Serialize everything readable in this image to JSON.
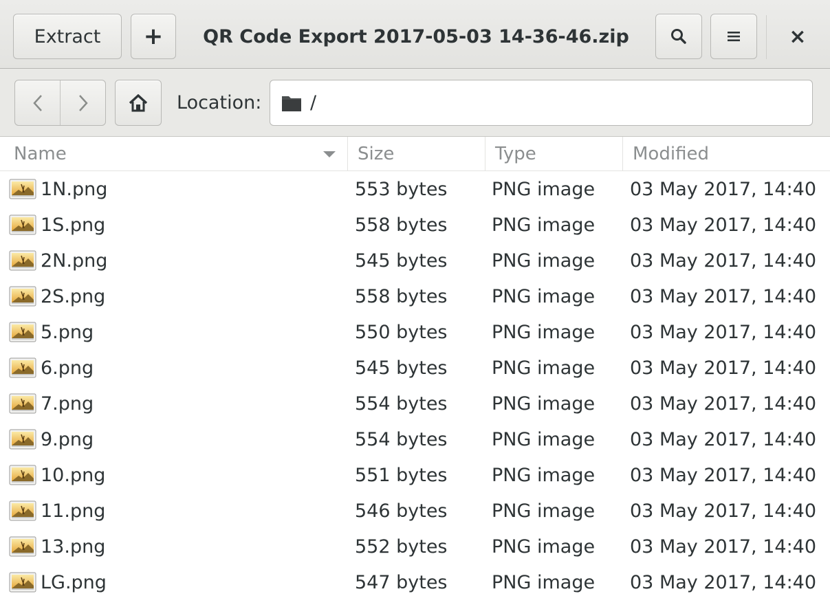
{
  "header": {
    "extract_label": "Extract",
    "add_label": "+",
    "title": "QR Code Export 2017-05-03 14-36-46.zip",
    "close_label": "×"
  },
  "locationbar": {
    "back_label": "<",
    "forward_label": ">",
    "location_label": "Location:",
    "path": "/"
  },
  "columns": {
    "name": "Name",
    "size": "Size",
    "type": "Type",
    "modified": "Modified"
  },
  "files": [
    {
      "name": "1N.png",
      "size": "553 bytes",
      "type": "PNG image",
      "modified": "03 May 2017, 14:40"
    },
    {
      "name": "1S.png",
      "size": "558 bytes",
      "type": "PNG image",
      "modified": "03 May 2017, 14:40"
    },
    {
      "name": "2N.png",
      "size": "545 bytes",
      "type": "PNG image",
      "modified": "03 May 2017, 14:40"
    },
    {
      "name": "2S.png",
      "size": "558 bytes",
      "type": "PNG image",
      "modified": "03 May 2017, 14:40"
    },
    {
      "name": "5.png",
      "size": "550 bytes",
      "type": "PNG image",
      "modified": "03 May 2017, 14:40"
    },
    {
      "name": "6.png",
      "size": "545 bytes",
      "type": "PNG image",
      "modified": "03 May 2017, 14:40"
    },
    {
      "name": "7.png",
      "size": "554 bytes",
      "type": "PNG image",
      "modified": "03 May 2017, 14:40"
    },
    {
      "name": "9.png",
      "size": "554 bytes",
      "type": "PNG image",
      "modified": "03 May 2017, 14:40"
    },
    {
      "name": "10.png",
      "size": "551 bytes",
      "type": "PNG image",
      "modified": "03 May 2017, 14:40"
    },
    {
      "name": "11.png",
      "size": "546 bytes",
      "type": "PNG image",
      "modified": "03 May 2017, 14:40"
    },
    {
      "name": "13.png",
      "size": "552 bytes",
      "type": "PNG image",
      "modified": "03 May 2017, 14:40"
    },
    {
      "name": "LG.png",
      "size": "547 bytes",
      "type": "PNG image",
      "modified": "03 May 2017, 14:40"
    }
  ]
}
